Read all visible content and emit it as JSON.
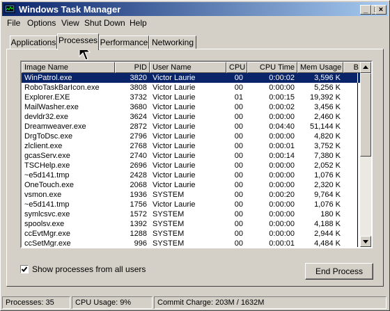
{
  "window": {
    "title": "Windows Task Manager"
  },
  "title_buttons": {
    "minimize": "_",
    "maximize": "□",
    "close": "×"
  },
  "menu": [
    {
      "label": "File"
    },
    {
      "label": "Options"
    },
    {
      "label": "View"
    },
    {
      "label": "Shut Down"
    },
    {
      "label": "Help"
    }
  ],
  "tabs": [
    {
      "label": "Applications"
    },
    {
      "label": "Processes"
    },
    {
      "label": "Performance"
    },
    {
      "label": "Networking"
    }
  ],
  "table": {
    "columns": [
      "Image Name",
      "PID",
      "User Name",
      "CPU",
      "CPU Time",
      "Mem Usage",
      "B"
    ],
    "rows": [
      [
        "WinPatrol.exe",
        "3820",
        "Victor Laurie",
        "00",
        "0:00:02",
        "3,596 K"
      ],
      [
        "RoboTaskBarIcon.exe",
        "3808",
        "Victor Laurie",
        "00",
        "0:00:00",
        "5,256 K"
      ],
      [
        "Explorer.EXE",
        "3732",
        "Victor Laurie",
        "01",
        "0:00:15",
        "19,392 K"
      ],
      [
        "MailWasher.exe",
        "3680",
        "Victor Laurie",
        "00",
        "0:00:02",
        "3,456 K"
      ],
      [
        "devldr32.exe",
        "3624",
        "Victor Laurie",
        "00",
        "0:00:00",
        "2,460 K"
      ],
      [
        "Dreamweaver.exe",
        "2872",
        "Victor Laurie",
        "00",
        "0:04:40",
        "51,144 K"
      ],
      [
        "DrgToDsc.exe",
        "2796",
        "Victor Laurie",
        "00",
        "0:00:00",
        "4,820 K"
      ],
      [
        "zlclient.exe",
        "2768",
        "Victor Laurie",
        "00",
        "0:00:01",
        "3,752 K"
      ],
      [
        "gcasServ.exe",
        "2740",
        "Victor Laurie",
        "00",
        "0:00:14",
        "7,380 K"
      ],
      [
        "TSCHelp.exe",
        "2696",
        "Victor Laurie",
        "00",
        "0:00:00",
        "2,052 K"
      ],
      [
        "~e5d141.tmp",
        "2428",
        "Victor Laurie",
        "00",
        "0:00:00",
        "1,076 K"
      ],
      [
        "OneTouch.exe",
        "2068",
        "Victor Laurie",
        "00",
        "0:00:00",
        "2,320 K"
      ],
      [
        "vsmon.exe",
        "1936",
        "SYSTEM",
        "00",
        "0:00:20",
        "9,764 K"
      ],
      [
        "~e5d141.tmp",
        "1756",
        "Victor Laurie",
        "00",
        "0:00:00",
        "1,076 K"
      ],
      [
        "symlcsvc.exe",
        "1572",
        "SYSTEM",
        "00",
        "0:00:00",
        "180 K"
      ],
      [
        "spoolsv.exe",
        "1392",
        "SYSTEM",
        "00",
        "0:00:00",
        "4,188 K"
      ],
      [
        "ccEvtMgr.exe",
        "1288",
        "SYSTEM",
        "00",
        "0:00:00",
        "2,944 K"
      ],
      [
        "ccSetMgr.exe",
        "996",
        "SYSTEM",
        "00",
        "0:00:01",
        "4,484 K"
      ]
    ]
  },
  "show_all_processes": {
    "label": "Show processes from all users",
    "checked": true
  },
  "end_process_button": "End Process",
  "statusbar": {
    "processes": "Processes: 35",
    "cpu": "CPU Usage: 9%",
    "commit": "Commit Charge: 203M / 1632M"
  },
  "colors": {
    "titlebar_start": "#0a246a",
    "titlebar_end": "#a6caf0",
    "selection": "#0a246a",
    "face": "#d4d0c8"
  },
  "icons": [
    "task-manager-icon",
    "minimize-icon",
    "maximize-icon",
    "close-icon",
    "scroll-up-icon",
    "scroll-down-icon",
    "checkmark-icon",
    "mouse-pointer-icon"
  ]
}
